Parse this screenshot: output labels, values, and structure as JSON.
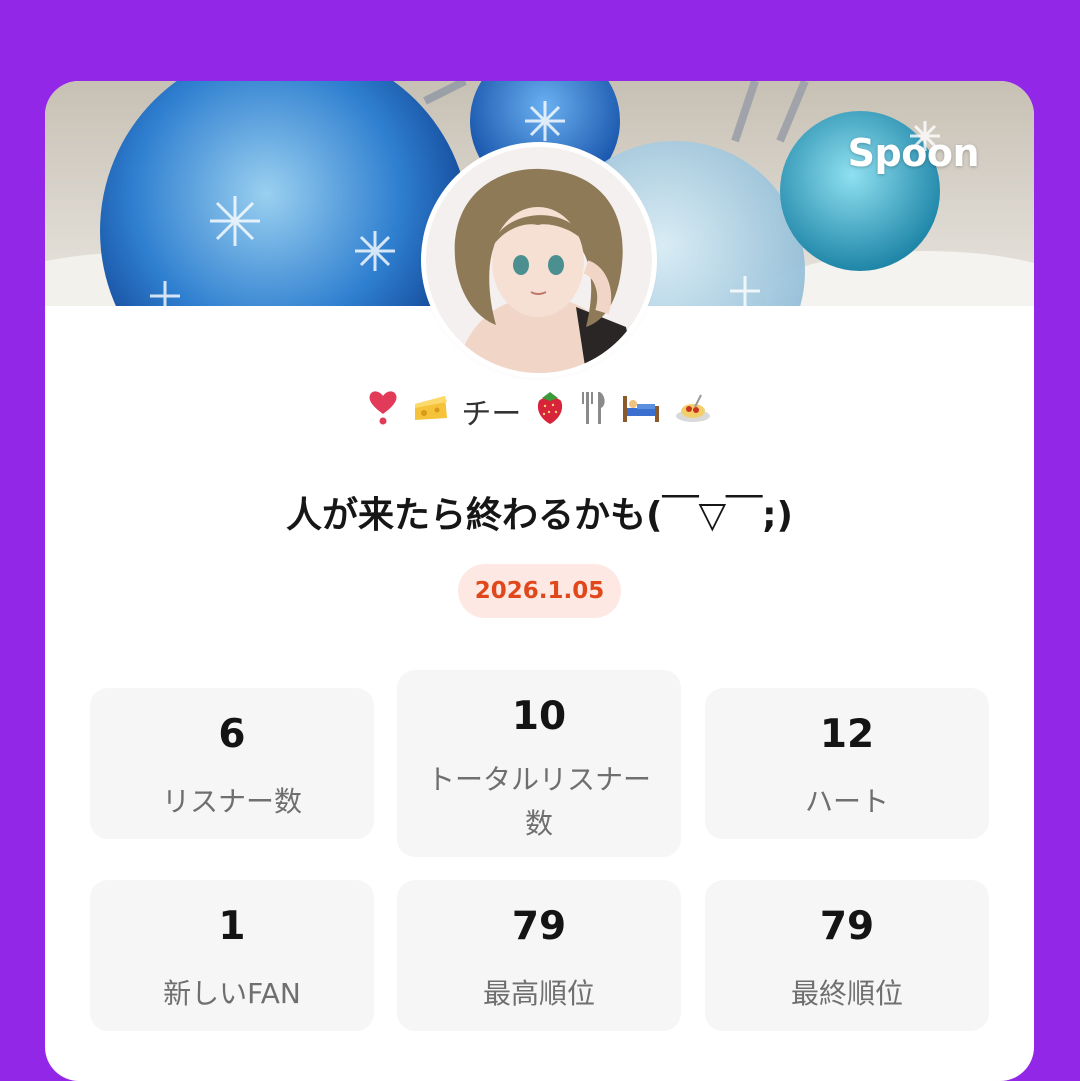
{
  "header": {
    "brand": "Spoon"
  },
  "profile": {
    "emoji_text": "チー",
    "title": "人が来たら終わるかも(￣▽￣;)",
    "date": "2026.1.05"
  },
  "stats": [
    {
      "value": "6",
      "label": "リスナー数"
    },
    {
      "value": "10",
      "label_line1": "トータルリスナー",
      "label_line2": "数"
    },
    {
      "value": "12",
      "label": "ハート"
    },
    {
      "value": "1",
      "label": "新しいFAN"
    },
    {
      "value": "79",
      "label": "最高順位"
    },
    {
      "value": "79",
      "label": "最終順位"
    }
  ],
  "colors": {
    "background": "#9227e8",
    "date_text": "#e0481b",
    "date_bg": "#fde8e3",
    "stat_bg": "#f6f6f6"
  }
}
